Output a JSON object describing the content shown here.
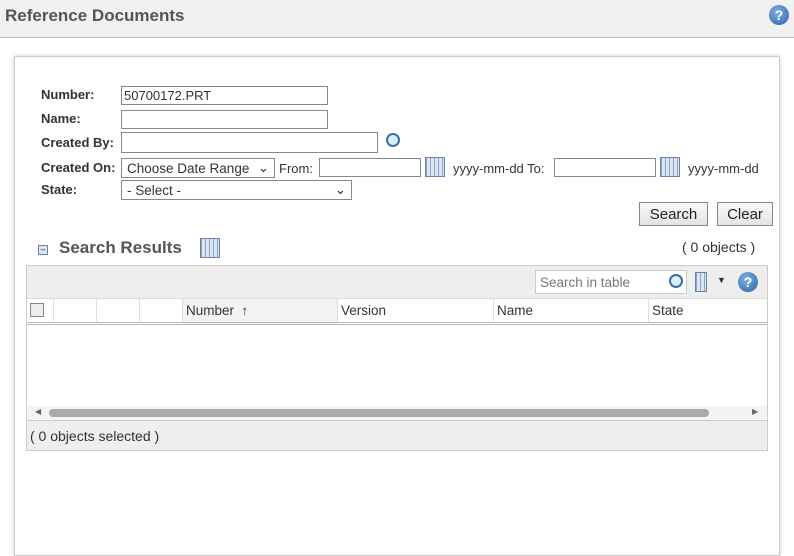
{
  "header": {
    "title": "Reference Documents",
    "help_icon": "help-icon"
  },
  "form": {
    "number_label": "Number:",
    "number_value": "50700172.PRT",
    "name_label": "Name:",
    "name_value": "",
    "created_by_label": "Created By:",
    "created_by_value": "",
    "created_on_label": "Created On:",
    "date_range_value": "Choose Date Range",
    "from_label": "From:",
    "from_value": "",
    "from_format": "yyyy-mm-dd To:",
    "to_value": "",
    "to_format": "yyyy-mm-dd",
    "state_label": "State:",
    "state_value": "- Select -",
    "search_button": "Search",
    "clear_button": "Clear"
  },
  "results": {
    "title": "Search Results",
    "count": "( 0 objects )",
    "search_placeholder": "Search in table",
    "columns": [
      "Number",
      "Version",
      "Name",
      "State"
    ],
    "sort_indicator": "↑",
    "selected": "( 0 objects selected )"
  }
}
